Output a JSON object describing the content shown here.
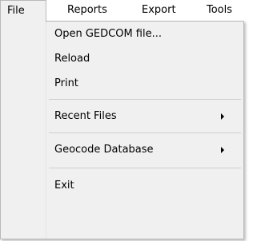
{
  "menubar": {
    "items": [
      {
        "label": "File"
      },
      {
        "label": "Reports"
      },
      {
        "label": "Export"
      },
      {
        "label": "Tools"
      }
    ]
  },
  "file_menu": {
    "items": [
      {
        "label": "Open GEDCOM file..."
      },
      {
        "label": "Reload"
      },
      {
        "label": "Print"
      },
      {
        "label": "Recent Files"
      },
      {
        "label": "Geocode Database"
      },
      {
        "label": "Exit"
      }
    ]
  }
}
